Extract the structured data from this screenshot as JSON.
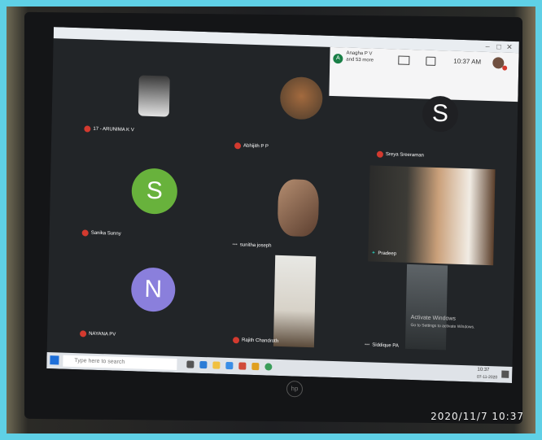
{
  "meeting": {
    "overflow_line1": "Anagha P V",
    "overflow_line2": "and 53 more",
    "clock": "10:37 AM",
    "avatar_a": "A"
  },
  "participants": [
    {
      "name": "17 - ARUNIMA K V",
      "type": "video"
    },
    {
      "name": "Abhijith P P",
      "type": "video"
    },
    {
      "name": "Sreya Sreeraman",
      "type": "avatar",
      "initial": "S",
      "color": "#1f2023"
    },
    {
      "name": "Sanika Sunny",
      "type": "avatar",
      "initial": "S",
      "color": "#68b23c"
    },
    {
      "name": "sunitha joseph",
      "type": "video"
    },
    {
      "name": "Pradeep",
      "type": "video"
    },
    {
      "name": "NAYANA PV",
      "type": "avatar",
      "initial": "N",
      "color": "#8a7fdc"
    },
    {
      "name": "Rajith Chandroth",
      "type": "video"
    },
    {
      "name": "Siddique PA",
      "type": "video"
    }
  ],
  "windows_watermark": {
    "line1": "Activate Windows",
    "line2": "Go to Settings to activate Windows."
  },
  "taskbar": {
    "search_placeholder": "Type here to search",
    "time": "10:37",
    "date": "07-11-2020"
  },
  "photo_timestamp": "2020/11/7  10:37",
  "brand_logo": "hp"
}
